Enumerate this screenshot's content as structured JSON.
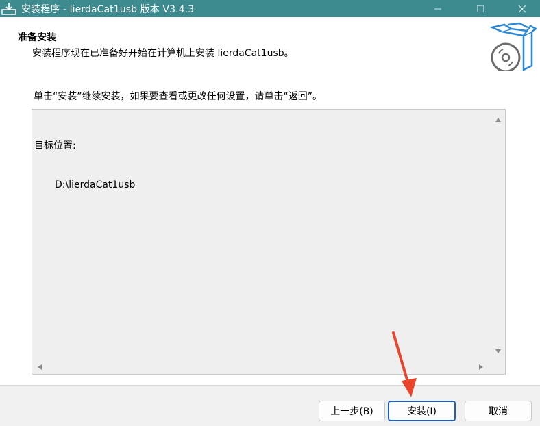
{
  "window": {
    "title": "安装程序 - lierdaCat1usb 版本 V3.4.3"
  },
  "header": {
    "title": "准备安装",
    "subtitle": "安装程序现在已准备好开始在计算机上安装 lierdaCat1usb。"
  },
  "instruction": "单击“安装”继续安装，如果要查看或更改任何设置，请单击“返回”。",
  "memo": {
    "label": "目标位置:",
    "value": "D:\\lierdaCat1usb"
  },
  "buttons": {
    "back": "上一步(B)",
    "install": "安装(I)",
    "cancel": "取消"
  },
  "colors": {
    "titlebar": "#3d8a8f",
    "accent": "#1f5fbf",
    "annotation_arrow": "#e8452c"
  }
}
